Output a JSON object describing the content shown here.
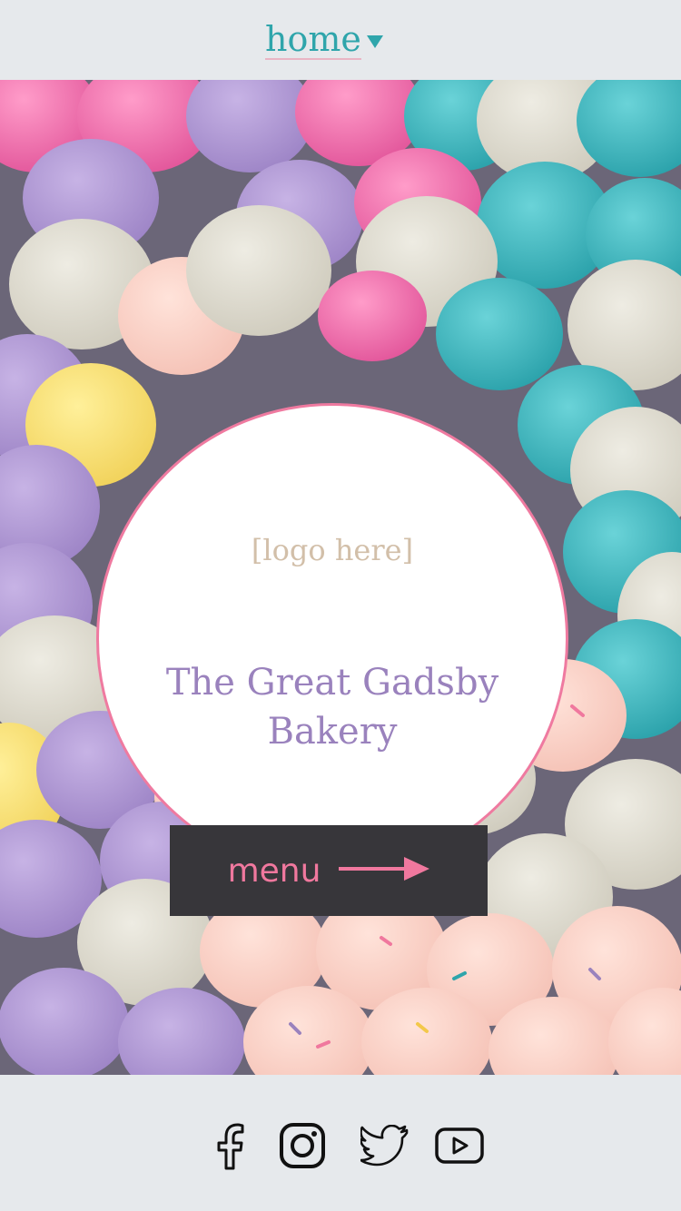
{
  "header": {
    "nav_label": "home",
    "nav_icon": "caret-down-icon"
  },
  "hero": {
    "background": "macarons-photo",
    "logo_placeholder": "[logo here]",
    "bakery_name_line1": "The Great Gadsby",
    "bakery_name_line2": "Bakery",
    "menu_button_label": "menu",
    "menu_button_icon": "arrow-right-icon"
  },
  "footer": {
    "social": [
      "facebook-icon",
      "instagram-icon",
      "twitter-icon",
      "youtube-icon"
    ]
  },
  "colors": {
    "accent_teal": "#2fa5ab",
    "accent_pink": "#ef7aa0",
    "bakery_purple": "#9a82bd",
    "button_dark": "#37363a",
    "background_gray": "#e6e9ec"
  }
}
